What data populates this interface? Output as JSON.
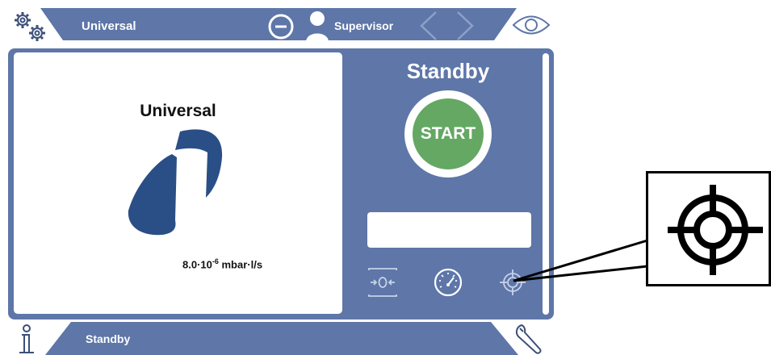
{
  "header": {
    "mode_title": "Universal",
    "user_label": "Supervisor"
  },
  "display": {
    "mode_name": "Universal",
    "leak_rate_mantissa": "8.0·10",
    "leak_rate_exponent": "-6",
    "leak_rate_unit": " mbar·l/s"
  },
  "control": {
    "status": "Standby",
    "start_label": "START",
    "value_box": ""
  },
  "footer": {
    "status": "Standby"
  },
  "colors": {
    "panel": "#5e76a8",
    "start": "#64a863",
    "logo": "#2a4f86"
  }
}
